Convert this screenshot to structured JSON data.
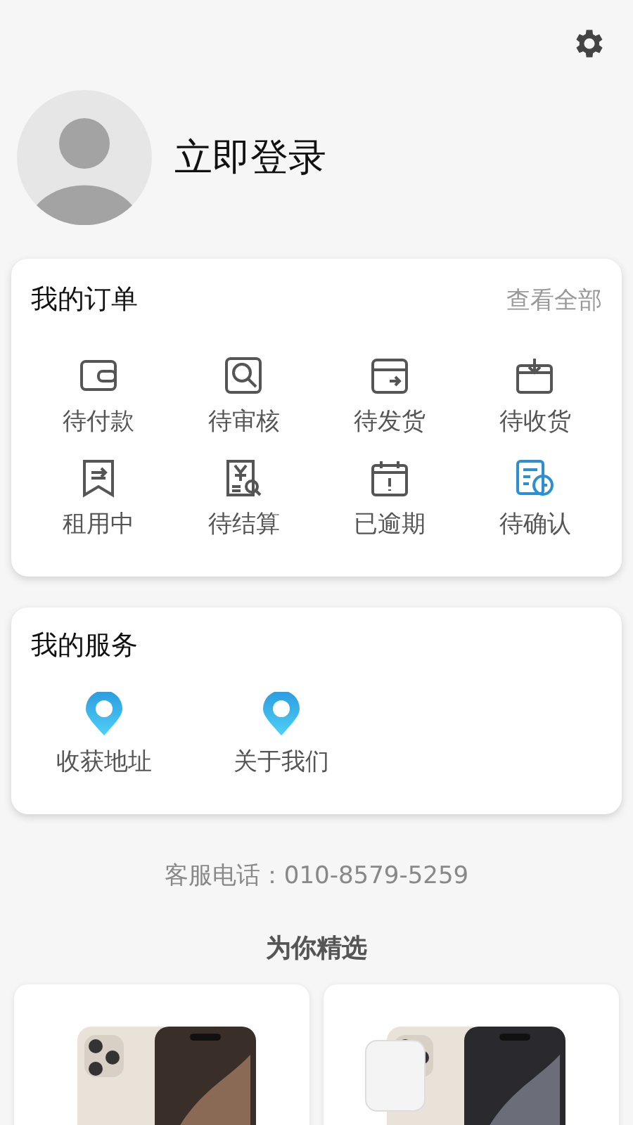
{
  "profile": {
    "login": "立即登录"
  },
  "orders": {
    "title": "我的订单",
    "view_all": "查看全部",
    "items": [
      {
        "label": "待付款",
        "color": "#555555"
      },
      {
        "label": "待审核",
        "color": "#555555"
      },
      {
        "label": "待发货",
        "color": "#555555"
      },
      {
        "label": "待收货",
        "color": "#555555"
      },
      {
        "label": "租用中",
        "color": "#555555"
      },
      {
        "label": "待结算",
        "color": "#555555"
      },
      {
        "label": "已逾期",
        "color": "#555555"
      },
      {
        "label": "待确认",
        "color": "#2a8fd4"
      }
    ]
  },
  "services": {
    "title": "我的服务",
    "items": [
      {
        "label": "收获地址"
      },
      {
        "label": "关于我们"
      }
    ]
  },
  "hotline": "客服电话：010-8579-5259",
  "featured": {
    "title": "为你精选"
  }
}
